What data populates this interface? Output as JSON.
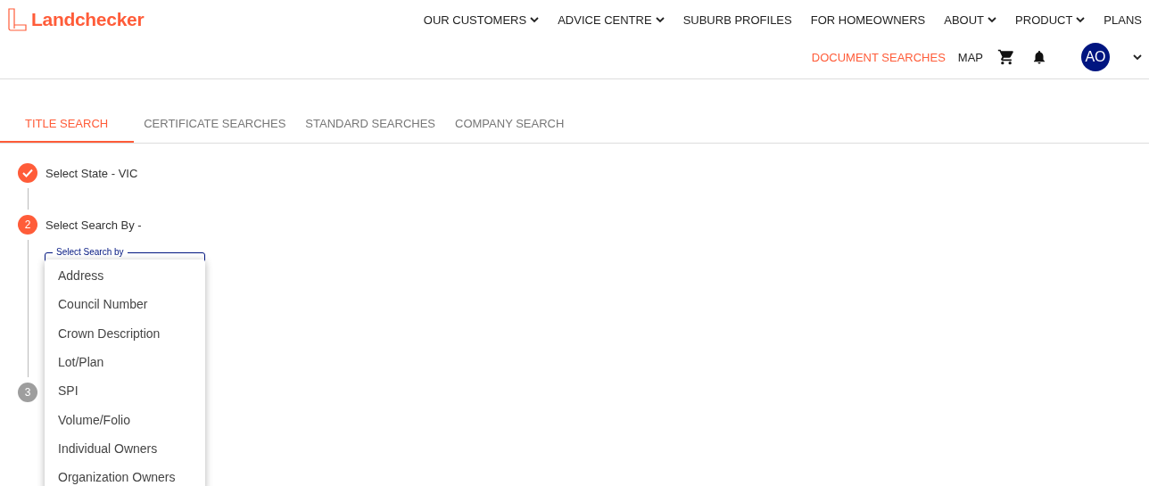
{
  "logo": {
    "text": "Landchecker"
  },
  "nav": [
    {
      "label": "OUR CUSTOMERS",
      "caret": true
    },
    {
      "label": "ADVICE CENTRE",
      "caret": true
    },
    {
      "label": "SUBURB PROFILES",
      "caret": false
    },
    {
      "label": "FOR HOMEOWNERS",
      "caret": false
    },
    {
      "label": "ABOUT",
      "caret": true
    },
    {
      "label": "PRODUCT",
      "caret": true
    },
    {
      "label": "PLANS",
      "caret": false
    }
  ],
  "subnav": [
    {
      "label": "DOCUMENT SEARCHES",
      "selected": true
    },
    {
      "label": "MAP",
      "selected": false
    }
  ],
  "avatar": {
    "initials": "AO"
  },
  "tabs": [
    {
      "label": "TITLE SEARCH",
      "selected": true
    },
    {
      "label": "CERTIFICATE SEARCHES",
      "selected": false
    },
    {
      "label": "STANDARD SEARCHES",
      "selected": false
    },
    {
      "label": "COMPANY SEARCH",
      "selected": false
    }
  ],
  "steps": [
    {
      "kind": "done",
      "label": "Select State - VIC"
    },
    {
      "kind": "active",
      "number": "2",
      "label": "Select Search By -"
    },
    {
      "kind": "pending",
      "number": "3"
    }
  ],
  "search_by": {
    "label": "Select Search by",
    "options": [
      "Address",
      "Council Number",
      "Crown Description",
      "Lot/Plan",
      "SPI",
      "Volume/Folio",
      "Individual Owners",
      "Organization Owners"
    ]
  }
}
